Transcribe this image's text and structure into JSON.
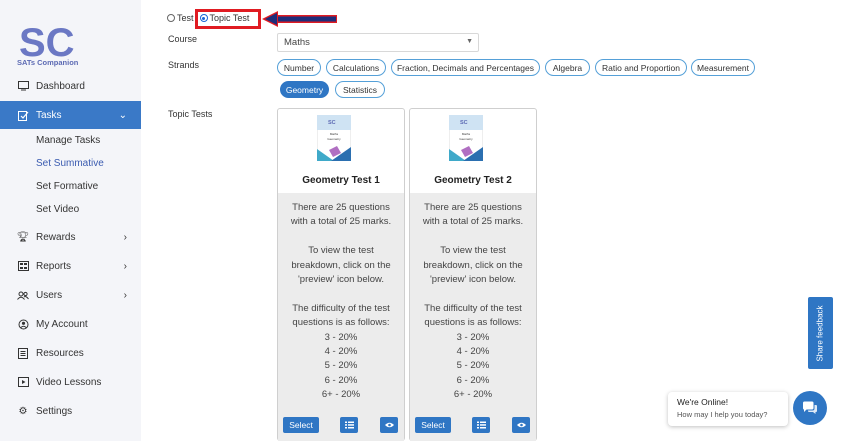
{
  "brand": {
    "logo_letters": "SC",
    "name": "SATs Companion"
  },
  "sidebar": {
    "items": [
      {
        "label": "Dashboard",
        "icon": "monitor-icon"
      },
      {
        "label": "Tasks",
        "icon": "tasks-icon",
        "active": true
      },
      {
        "label": "Rewards",
        "icon": "trophy-icon"
      },
      {
        "label": "Reports",
        "icon": "reports-icon"
      },
      {
        "label": "Users",
        "icon": "users-icon"
      },
      {
        "label": "My Account",
        "icon": "account-icon"
      },
      {
        "label": "Resources",
        "icon": "resources-icon"
      },
      {
        "label": "Video Lessons",
        "icon": "video-icon"
      },
      {
        "label": "Settings",
        "icon": "gear-icon"
      }
    ],
    "tasks_sub": [
      "Manage Tasks",
      "Set Summative",
      "Set Formative",
      "Set Video"
    ],
    "current_sub": "Set Summative"
  },
  "mode": {
    "option_test": "Test",
    "option_topic": "Topic Test",
    "selected": "Topic Test"
  },
  "labels": {
    "course": "Course",
    "strands": "Strands",
    "topic_tests": "Topic Tests"
  },
  "course": {
    "value": "Maths"
  },
  "strands": [
    "Number",
    "Calculations",
    "Fraction, Decimals and Percentages",
    "Algebra",
    "Ratio and Proportion",
    "Measurement",
    "Geometry",
    "Statistics"
  ],
  "selected_strand": "Geometry",
  "cards": [
    {
      "title": "Geometry Test 1",
      "thumb_title": "Maths",
      "thumb_sub": "Geometry",
      "lines": [
        "There are 25 questions",
        "with a total of 25 marks.",
        "",
        "To view the test",
        "breakdown, click on the",
        "'preview' icon below.",
        "",
        "The difficulty of the test",
        "questions is as follows:",
        "3 - 20%",
        "4 - 20%",
        "5 - 20%",
        "6 - 20%",
        "6+ - 20%"
      ],
      "select_label": "Select"
    },
    {
      "title": "Geometry Test 2",
      "thumb_title": "Maths",
      "thumb_sub": "Geometry",
      "lines": [
        "There are 25 questions",
        "with a total of 25 marks.",
        "",
        "To view the test",
        "breakdown, click on the",
        "'preview' icon below.",
        "",
        "The difficulty of the test",
        "questions is as follows:",
        "3 - 20%",
        "4 - 20%",
        "5 - 20%",
        "6 - 20%",
        "6+ - 20%"
      ],
      "select_label": "Select"
    }
  ],
  "feedback": {
    "label": "Share feedback"
  },
  "chat": {
    "title": "We're Online!",
    "subtitle": "How may I help you today?"
  },
  "colors": {
    "primary": "#2f76c4",
    "highlight": "#e01b22",
    "sidebar_bg": "#f4f5f9"
  }
}
